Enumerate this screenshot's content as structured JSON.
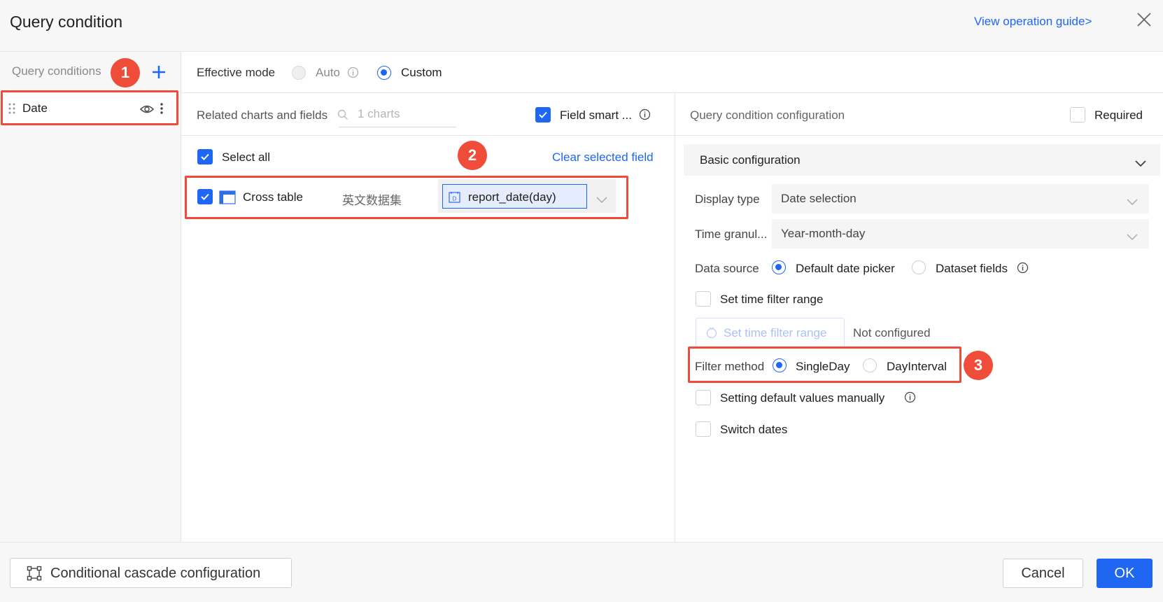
{
  "dialog": {
    "title": "Query condition",
    "guide_link": "View operation guide>"
  },
  "left": {
    "header": "Query conditions",
    "items": [
      {
        "label": "Date"
      }
    ]
  },
  "effective_mode": {
    "label": "Effective mode",
    "options": [
      "Auto",
      "Custom"
    ],
    "selected": "Custom"
  },
  "related": {
    "label": "Related charts and fields",
    "search_placeholder": "1 charts",
    "smart_label": "Field smart ...",
    "select_all": "Select all",
    "clear_link": "Clear selected field",
    "rows": [
      {
        "chart": "Cross table",
        "dataset": "英文数据集",
        "field": "report_date(day)",
        "field_type": "D"
      }
    ]
  },
  "config": {
    "header": "Query condition configuration",
    "required_label": "Required",
    "section_title": "Basic configuration",
    "display_type_label": "Display type",
    "display_type_value": "Date selection",
    "granularity_label": "Time granul...",
    "granularity_value": "Year-month-day",
    "data_source_label": "Data source",
    "data_source_options": [
      "Default date picker",
      "Dataset fields"
    ],
    "data_source_selected": "Default date picker",
    "set_range_check": "Set time filter range",
    "set_range_button": "Set time filter range",
    "not_configured": "Not configured",
    "filter_method_label": "Filter method",
    "filter_method_options": [
      "SingleDay",
      "DayInterval"
    ],
    "filter_method_selected": "SingleDay",
    "default_values_check": "Setting default values manually",
    "switch_dates_check": "Switch dates"
  },
  "badges": [
    "1",
    "2",
    "3"
  ],
  "footer": {
    "cascade_button": "Conditional cascade configuration",
    "cancel_button": "Cancel",
    "ok_button": "OK"
  },
  "colors": {
    "accent": "#1f66f2",
    "highlight": "#f04a3a"
  }
}
